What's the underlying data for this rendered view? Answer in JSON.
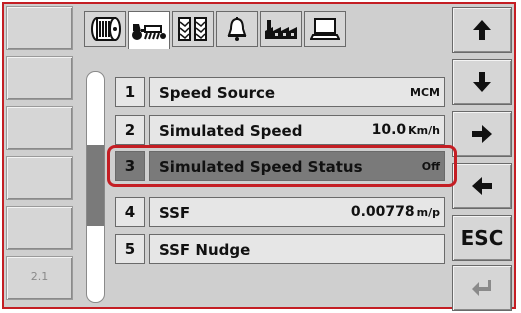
{
  "left_softkeys": [
    "",
    "",
    "",
    "",
    "",
    "2.1"
  ],
  "tabs": [
    {
      "icon": "tire-icon",
      "active": false
    },
    {
      "icon": "tractor-implement-icon",
      "active": true
    },
    {
      "icon": "tracks-icon",
      "active": false
    },
    {
      "icon": "bell-icon",
      "active": false
    },
    {
      "icon": "factory-icon",
      "active": false
    },
    {
      "icon": "monitor-icon",
      "active": false
    }
  ],
  "right_softkeys": [
    {
      "icon": "arrow-up-icon",
      "label": ""
    },
    {
      "icon": "arrow-down-icon",
      "label": ""
    },
    {
      "icon": "arrow-right-icon",
      "label": ""
    },
    {
      "icon": "arrow-left-icon",
      "label": ""
    },
    {
      "icon": "",
      "label": "ESC"
    },
    {
      "icon": "enter-icon",
      "label": ""
    }
  ],
  "rows": [
    {
      "number": "1",
      "name": "Speed Source",
      "value": "MCM",
      "unit": ""
    },
    {
      "number": "2",
      "name": "Simulated Speed",
      "value": "10.0",
      "unit": "Km/h"
    },
    {
      "number": "3",
      "name": "Simulated Speed Status",
      "value": "Off",
      "unit": ""
    },
    {
      "number": "4",
      "name": "SSF",
      "value": "0.00778",
      "unit": "m/p"
    },
    {
      "number": "5",
      "name": "SSF Nudge",
      "value": "",
      "unit": ""
    }
  ],
  "selected_row": 3,
  "colors": {
    "highlight": "#c41e24",
    "selected_row": "#7a7a7a",
    "panel": "#cfcfcf"
  }
}
